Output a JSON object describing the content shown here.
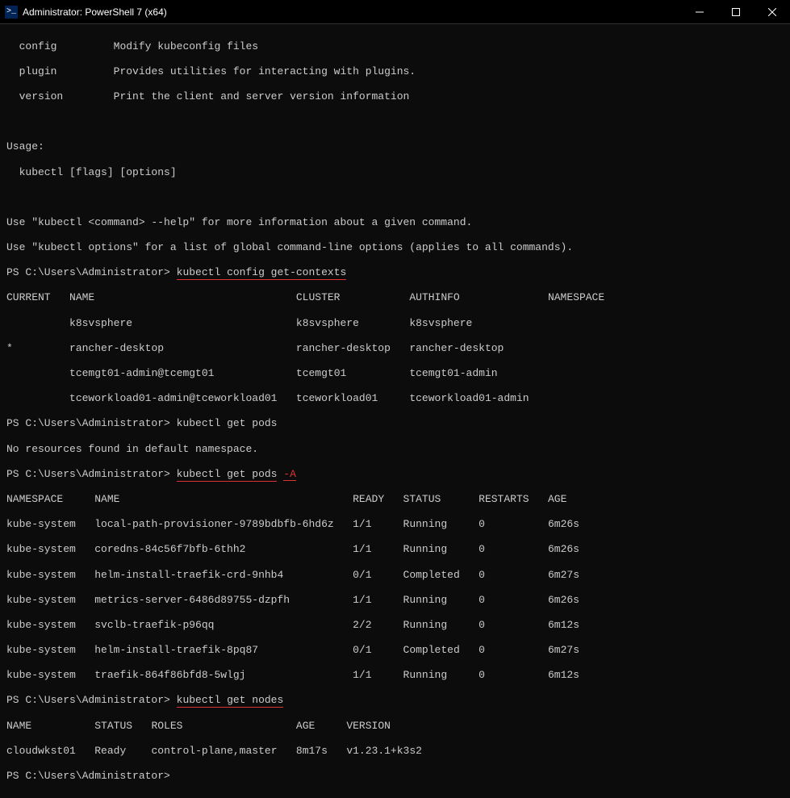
{
  "window": {
    "title": "Administrator: PowerShell 7 (x64)",
    "icon_label": ">_"
  },
  "help": {
    "config": {
      "cmd": "config",
      "desc": "Modify kubeconfig files"
    },
    "plugin": {
      "cmd": "plugin",
      "desc": "Provides utilities for interacting with plugins."
    },
    "version": {
      "cmd": "version",
      "desc": "Print the client and server version information"
    }
  },
  "usage": {
    "label": "Usage:",
    "line": "  kubectl [flags] [options]"
  },
  "hints": {
    "l1": "Use \"kubectl <command> --help\" for more information about a given command.",
    "l2": "Use \"kubectl options\" for a list of global command-line options (applies to all commands)."
  },
  "prompts": {
    "p1": "PS C:\\Users\\Administrator>",
    "cmd1": "kubectl config get-contexts",
    "cmd2": "kubectl get pods",
    "cmd3a": "kubectl get pods",
    "cmd3b": "-A",
    "cmd4": "kubectl get nodes"
  },
  "contexts": {
    "header": {
      "current": "CURRENT",
      "name": "NAME",
      "cluster": "CLUSTER",
      "authinfo": "AUTHINFO",
      "namespace": "NAMESPACE"
    },
    "rows": [
      {
        "current": " ",
        "name": "k8svsphere",
        "cluster": "k8svsphere",
        "authinfo": "k8svsphere"
      },
      {
        "current": "*",
        "name": "rancher-desktop",
        "cluster": "rancher-desktop",
        "authinfo": "rancher-desktop"
      },
      {
        "current": " ",
        "name": "tcemgt01-admin@tcemgt01",
        "cluster": "tcemgt01",
        "authinfo": "tcemgt01-admin"
      },
      {
        "current": " ",
        "name": "tceworkload01-admin@tceworkload01",
        "cluster": "tceworkload01",
        "authinfo": "tceworkload01-admin"
      }
    ]
  },
  "noResources": "No resources found in default namespace.",
  "pods": {
    "header": {
      "namespace": "NAMESPACE",
      "name": "NAME",
      "ready": "READY",
      "status": "STATUS",
      "restarts": "RESTARTS",
      "age": "AGE"
    },
    "rows": [
      {
        "namespace": "kube-system",
        "name": "local-path-provisioner-9789bdbfb-6hd6z",
        "ready": "1/1",
        "status": "Running",
        "restarts": "0",
        "age": "6m26s"
      },
      {
        "namespace": "kube-system",
        "name": "coredns-84c56f7bfb-6thh2",
        "ready": "1/1",
        "status": "Running",
        "restarts": "0",
        "age": "6m26s"
      },
      {
        "namespace": "kube-system",
        "name": "helm-install-traefik-crd-9nhb4",
        "ready": "0/1",
        "status": "Completed",
        "restarts": "0",
        "age": "6m27s"
      },
      {
        "namespace": "kube-system",
        "name": "metrics-server-6486d89755-dzpfh",
        "ready": "1/1",
        "status": "Running",
        "restarts": "0",
        "age": "6m26s"
      },
      {
        "namespace": "kube-system",
        "name": "svclb-traefik-p96qq",
        "ready": "2/2",
        "status": "Running",
        "restarts": "0",
        "age": "6m12s"
      },
      {
        "namespace": "kube-system",
        "name": "helm-install-traefik-8pq87",
        "ready": "0/1",
        "status": "Completed",
        "restarts": "0",
        "age": "6m27s"
      },
      {
        "namespace": "kube-system",
        "name": "traefik-864f86bfd8-5wlgj",
        "ready": "1/1",
        "status": "Running",
        "restarts": "0",
        "age": "6m12s"
      }
    ]
  },
  "nodes": {
    "header": {
      "name": "NAME",
      "status": "STATUS",
      "roles": "ROLES",
      "age": "AGE",
      "version": "VERSION"
    },
    "rows": [
      {
        "name": "cloudwkst01",
        "status": "Ready",
        "roles": "control-plane,master",
        "age": "8m17s",
        "version": "v1.23.1+k3s2"
      }
    ]
  }
}
